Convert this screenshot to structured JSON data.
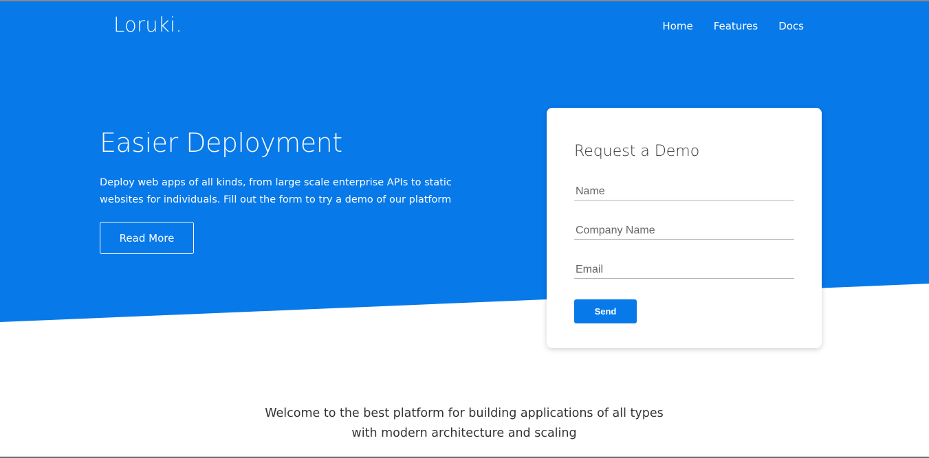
{
  "header": {
    "logo": "Loruki.",
    "nav": [
      {
        "label": "Home"
      },
      {
        "label": "Features"
      },
      {
        "label": "Docs"
      }
    ]
  },
  "hero": {
    "title": "Easier Deployment",
    "text": "Deploy web apps of all kinds, from large scale enterprise APIs to static websites for individuals. Fill out the form to try a demo of our platform",
    "read_more_label": "Read More"
  },
  "demo_form": {
    "title": "Request a Demo",
    "name_placeholder": "Name",
    "company_placeholder": "Company Name",
    "email_placeholder": "Email",
    "send_label": "Send"
  },
  "welcome": {
    "text": "Welcome to the best platform for building applications of all types with modern architecture and scaling"
  },
  "colors": {
    "primary": "#0779e9",
    "text_dark": "#333333"
  }
}
